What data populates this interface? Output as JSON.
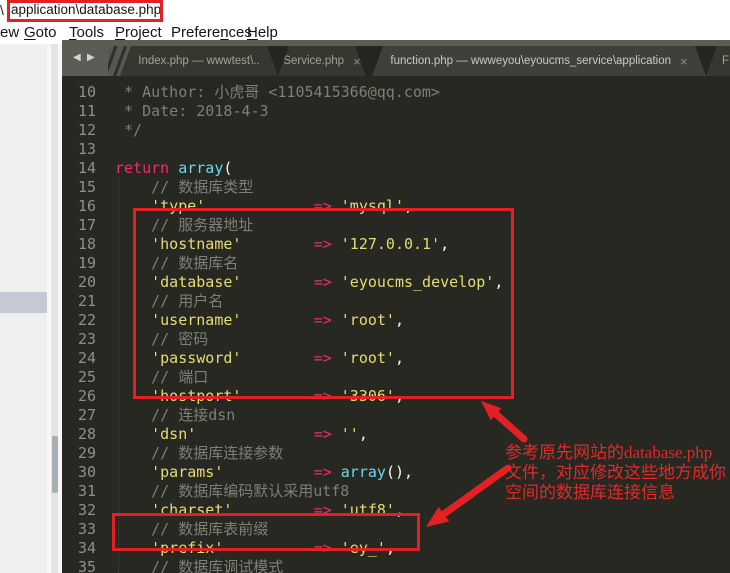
{
  "window": {
    "title_partial": "\\",
    "title": "application\\database.php"
  },
  "menubar": {
    "items": [
      {
        "name": "menu-item-view-partial",
        "pre": "ew",
        "u": "",
        "post": ""
      },
      {
        "name": "menu-item-goto",
        "pre": "",
        "u": "G",
        "post": "oto"
      },
      {
        "name": "menu-item-tools",
        "pre": "",
        "u": "T",
        "post": "ools"
      },
      {
        "name": "menu-item-project",
        "pre": "",
        "u": "P",
        "post": "roject"
      },
      {
        "name": "menu-item-preferences",
        "pre": "Prefere",
        "u": "n",
        "post": "ces"
      },
      {
        "name": "menu-item-help",
        "pre": "",
        "u": "H",
        "post": "elp"
      }
    ]
  },
  "tabs": {
    "nav_back": "◀",
    "nav_fwd": "▶",
    "close_glyph": "×",
    "items": [
      {
        "label": "Index.php — wwwtest\\..",
        "active": false,
        "closable": false
      },
      {
        "label": "Service.php",
        "active": false,
        "closable": true
      },
      {
        "label": "function.php — wwweyou\\eyoucms_service\\application",
        "active": true,
        "closable": true
      },
      {
        "label": "F",
        "active": false,
        "closable": false
      }
    ]
  },
  "editor": {
    "lines": [
      {
        "n": "10",
        "tokens": [
          {
            "c": "cm",
            "t": " * Author: 小虎哥 <1105415366@qq.com>"
          }
        ]
      },
      {
        "n": "11",
        "tokens": [
          {
            "c": "cm",
            "t": " * Date: 2018-4-3"
          }
        ]
      },
      {
        "n": "12",
        "tokens": [
          {
            "c": "cm",
            "t": " */"
          }
        ]
      },
      {
        "n": "13",
        "tokens": []
      },
      {
        "n": "14",
        "tokens": [
          {
            "c": "k",
            "t": "return"
          },
          {
            "c": "pl",
            "t": " "
          },
          {
            "c": "fn",
            "t": "array"
          },
          {
            "c": "pl",
            "t": "("
          }
        ]
      },
      {
        "n": "15",
        "tokens": [
          {
            "c": "cm",
            "t": "    // 数据库类型"
          }
        ]
      },
      {
        "n": "16",
        "tokens": [
          {
            "c": "pl",
            "t": "    "
          },
          {
            "c": "s",
            "t": "'type'"
          },
          {
            "c": "pl",
            "t": "            "
          },
          {
            "c": "k",
            "t": "=>"
          },
          {
            "c": "pl",
            "t": " "
          },
          {
            "c": "s",
            "t": "'mysql'"
          },
          {
            "c": "pl",
            "t": ","
          }
        ]
      },
      {
        "n": "17",
        "tokens": [
          {
            "c": "cm",
            "t": "    // 服务器地址"
          }
        ]
      },
      {
        "n": "18",
        "tokens": [
          {
            "c": "pl",
            "t": "    "
          },
          {
            "c": "s",
            "t": "'hostname'"
          },
          {
            "c": "pl",
            "t": "        "
          },
          {
            "c": "k",
            "t": "=>"
          },
          {
            "c": "pl",
            "t": " "
          },
          {
            "c": "s",
            "t": "'127.0.0.1'"
          },
          {
            "c": "pl",
            "t": ","
          }
        ]
      },
      {
        "n": "19",
        "tokens": [
          {
            "c": "cm",
            "t": "    // 数据库名"
          }
        ]
      },
      {
        "n": "20",
        "tokens": [
          {
            "c": "pl",
            "t": "    "
          },
          {
            "c": "s",
            "t": "'database'"
          },
          {
            "c": "pl",
            "t": "        "
          },
          {
            "c": "k",
            "t": "=>"
          },
          {
            "c": "pl",
            "t": " "
          },
          {
            "c": "s",
            "t": "'eyoucms_develop'"
          },
          {
            "c": "pl",
            "t": ","
          }
        ]
      },
      {
        "n": "21",
        "tokens": [
          {
            "c": "cm",
            "t": "    // 用户名"
          }
        ]
      },
      {
        "n": "22",
        "tokens": [
          {
            "c": "pl",
            "t": "    "
          },
          {
            "c": "s",
            "t": "'username'"
          },
          {
            "c": "pl",
            "t": "        "
          },
          {
            "c": "k",
            "t": "=>"
          },
          {
            "c": "pl",
            "t": " "
          },
          {
            "c": "s",
            "t": "'root'"
          },
          {
            "c": "pl",
            "t": ","
          }
        ]
      },
      {
        "n": "23",
        "tokens": [
          {
            "c": "cm",
            "t": "    // 密码"
          }
        ]
      },
      {
        "n": "24",
        "tokens": [
          {
            "c": "pl",
            "t": "    "
          },
          {
            "c": "s",
            "t": "'password'"
          },
          {
            "c": "pl",
            "t": "        "
          },
          {
            "c": "k",
            "t": "=>"
          },
          {
            "c": "pl",
            "t": " "
          },
          {
            "c": "s",
            "t": "'root'"
          },
          {
            "c": "pl",
            "t": ","
          }
        ]
      },
      {
        "n": "25",
        "tokens": [
          {
            "c": "cm",
            "t": "    // 端口"
          }
        ]
      },
      {
        "n": "26",
        "tokens": [
          {
            "c": "pl",
            "t": "    "
          },
          {
            "c": "s",
            "t": "'hostport'"
          },
          {
            "c": "pl",
            "t": "        "
          },
          {
            "c": "k",
            "t": "=>"
          },
          {
            "c": "pl",
            "t": " "
          },
          {
            "c": "s",
            "t": "'3306'"
          },
          {
            "c": "pl",
            "t": ","
          }
        ]
      },
      {
        "n": "27",
        "tokens": [
          {
            "c": "cm",
            "t": "    // 连接dsn"
          }
        ]
      },
      {
        "n": "28",
        "tokens": [
          {
            "c": "pl",
            "t": "    "
          },
          {
            "c": "s",
            "t": "'dsn'"
          },
          {
            "c": "pl",
            "t": "             "
          },
          {
            "c": "k",
            "t": "=>"
          },
          {
            "c": "pl",
            "t": " "
          },
          {
            "c": "s",
            "t": "''"
          },
          {
            "c": "pl",
            "t": ","
          }
        ]
      },
      {
        "n": "29",
        "tokens": [
          {
            "c": "cm",
            "t": "    // 数据库连接参数"
          }
        ]
      },
      {
        "n": "30",
        "tokens": [
          {
            "c": "pl",
            "t": "    "
          },
          {
            "c": "s",
            "t": "'params'"
          },
          {
            "c": "pl",
            "t": "          "
          },
          {
            "c": "k",
            "t": "=>"
          },
          {
            "c": "pl",
            "t": " "
          },
          {
            "c": "fn",
            "t": "array"
          },
          {
            "c": "pl",
            "t": "(),"
          }
        ]
      },
      {
        "n": "31",
        "tokens": [
          {
            "c": "cm",
            "t": "    // 数据库编码默认采用utf8"
          }
        ]
      },
      {
        "n": "32",
        "tokens": [
          {
            "c": "pl",
            "t": "    "
          },
          {
            "c": "s",
            "t": "'charset'"
          },
          {
            "c": "pl",
            "t": "         "
          },
          {
            "c": "k",
            "t": "=>"
          },
          {
            "c": "pl",
            "t": " "
          },
          {
            "c": "s",
            "t": "'utf8'"
          },
          {
            "c": "pl",
            "t": ","
          }
        ]
      },
      {
        "n": "33",
        "tokens": [
          {
            "c": "cm",
            "t": "    // 数据库表前缀"
          }
        ]
      },
      {
        "n": "34",
        "tokens": [
          {
            "c": "pl",
            "t": "    "
          },
          {
            "c": "s",
            "t": "'prefix'"
          },
          {
            "c": "pl",
            "t": "          "
          },
          {
            "c": "k",
            "t": "=>"
          },
          {
            "c": "pl",
            "t": " "
          },
          {
            "c": "s",
            "t": "'ey_'"
          },
          {
            "c": "pl",
            "t": ","
          }
        ]
      },
      {
        "n": "35",
        "tokens": [
          {
            "c": "cm",
            "t": "    // 数据库调试模式"
          }
        ]
      }
    ]
  },
  "annotations": {
    "accent_color": "#e32125",
    "note_lines": [
      "参考原先网站的database.php",
      "文件，对应修改这些地方成你",
      "空间的数据库连接信息"
    ]
  },
  "colors": {
    "editor_bg": "#272822",
    "string": "#e6db74",
    "keyword": "#f92672",
    "function": "#66d9ef",
    "comment": "#7e7f75",
    "line_number": "#8f908a"
  }
}
